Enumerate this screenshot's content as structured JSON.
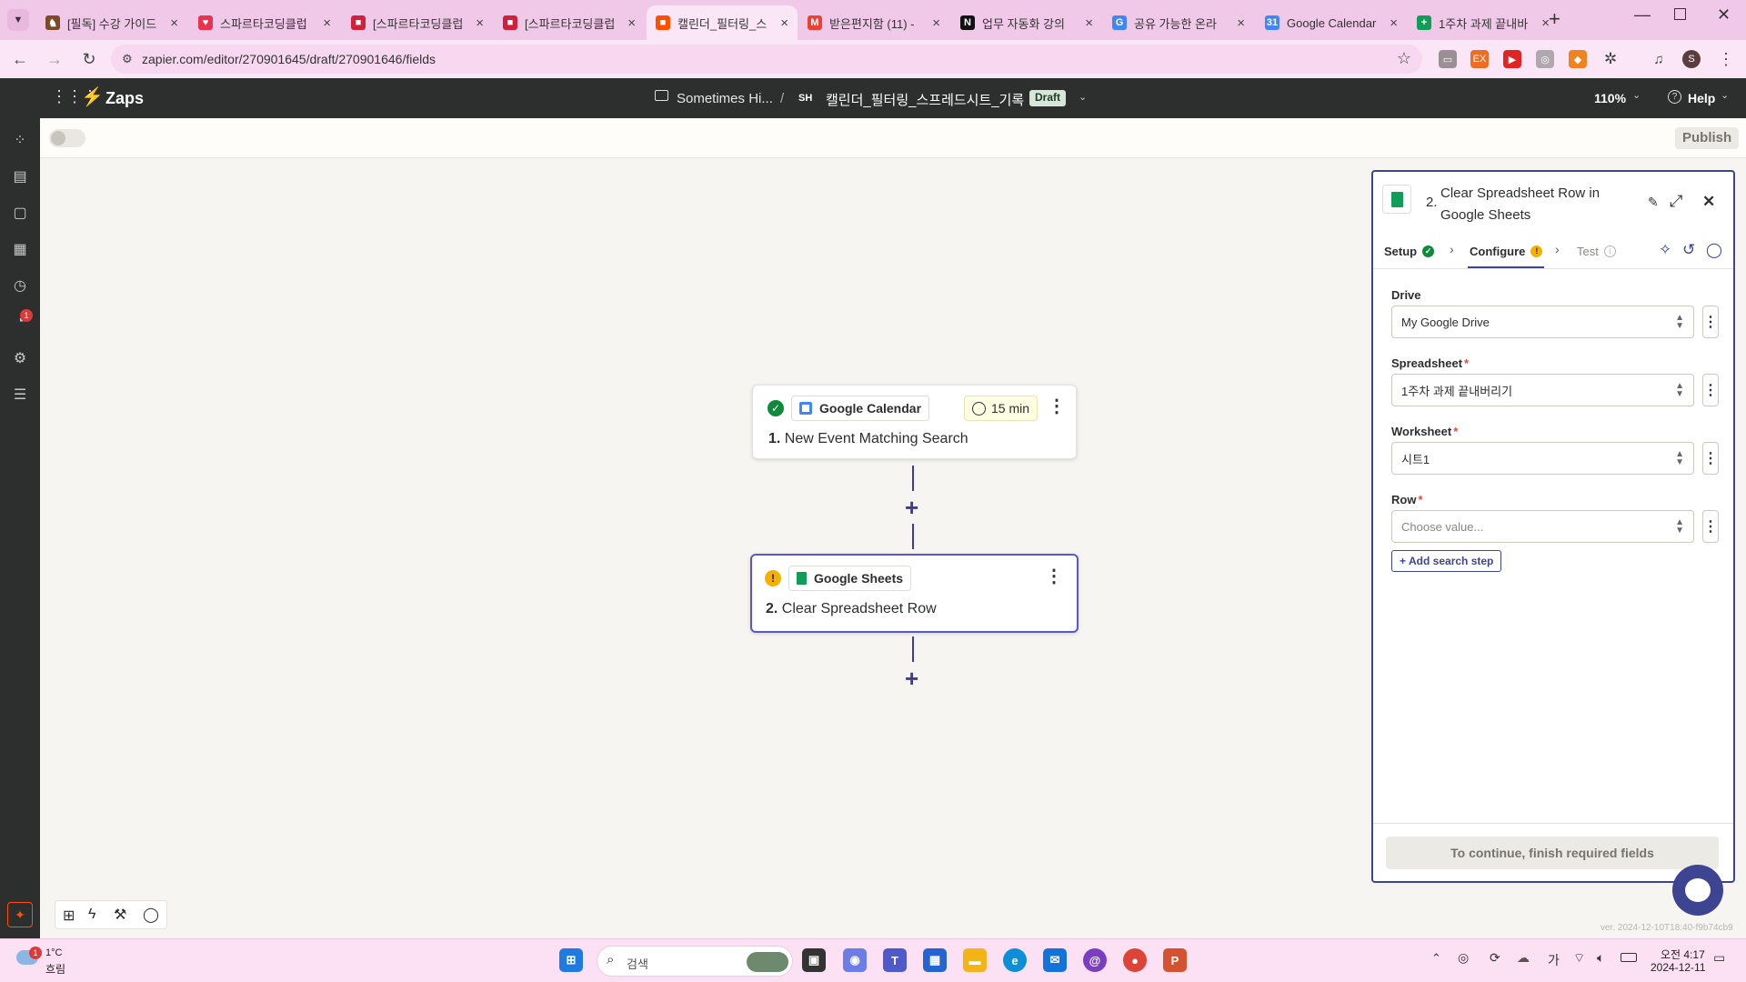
{
  "browser": {
    "tabs": [
      {
        "title": "[필독] 수강 가이드",
        "color": "#7a4a2a",
        "glyph": "♞"
      },
      {
        "title": "스파르타코딩클럽",
        "color": "#e8344e",
        "glyph": "♥"
      },
      {
        "title": "[스파르타코딩클럽",
        "color": "#d1203d",
        "glyph": "■"
      },
      {
        "title": "[스파르타코딩클럽",
        "color": "#d1203d",
        "glyph": "■"
      },
      {
        "title": "캘린더_필터링_스",
        "color": "#ff4f00",
        "glyph": "■"
      },
      {
        "title": "받은편지함 (11) -",
        "color": "#ea4335",
        "glyph": "M"
      },
      {
        "title": "업무 자동화 강의",
        "color": "#111111",
        "glyph": "N"
      },
      {
        "title": "공유 가능한 온라",
        "color": "#4285f4",
        "glyph": "G"
      },
      {
        "title": "Google Calendar",
        "color": "#4285f4",
        "glyph": "31"
      },
      {
        "title": "1주차 과제 끝내바",
        "color": "#0f9d58",
        "glyph": "+"
      }
    ],
    "url": "zapier.com/editor/270901645/draft/270901646/fields",
    "profile_initial": "S"
  },
  "header": {
    "app_name": "Zaps",
    "folder": "Sometimes Hi...",
    "separator": "/",
    "owner_initials": "SH",
    "zap_title": "캘린더_필터링_스프레드시트_기록",
    "status_badge": "Draft",
    "zoom": "110%",
    "help": "Help"
  },
  "sidebar": {
    "notification_count": "1"
  },
  "toolbar": {
    "publish": "Publish"
  },
  "steps": [
    {
      "app": "Google Calendar",
      "timer": "15 min",
      "number": "1.",
      "title": "New Event Matching Search",
      "status": "complete"
    },
    {
      "app": "Google Sheets",
      "number": "2.",
      "title": "Clear Spreadsheet Row",
      "status": "warning"
    }
  ],
  "panel": {
    "step_number": "2.",
    "title": "Clear Spreadsheet Row in Google Sheets",
    "tabs": {
      "setup": "Setup",
      "configure": "Configure",
      "test": "Test"
    },
    "fields": [
      {
        "label": "Drive",
        "required": false,
        "value": "My Google Drive"
      },
      {
        "label": "Spreadsheet",
        "required": true,
        "value": "1주차 과제 끝내버리기"
      },
      {
        "label": "Worksheet",
        "required": true,
        "value": "시트1"
      },
      {
        "label": "Row",
        "required": true,
        "value": "",
        "placeholder": "Choose value..."
      }
    ],
    "add_search_step": "Add search step",
    "continue_button": "To continue, finish required fields"
  },
  "version": "ver. 2024-12-10T18:40-f9b74cb9",
  "taskbar": {
    "weather_temp": "1°C",
    "weather_desc": "흐림",
    "weather_badge": "1",
    "search_placeholder": "검색",
    "ime": "가",
    "time": "오전 4:17",
    "date": "2024-12-11"
  },
  "colors": {
    "accent": "#3d4592",
    "zapier_orange": "#ff4f00",
    "success": "#0f8a3a",
    "warning": "#f5b100"
  }
}
